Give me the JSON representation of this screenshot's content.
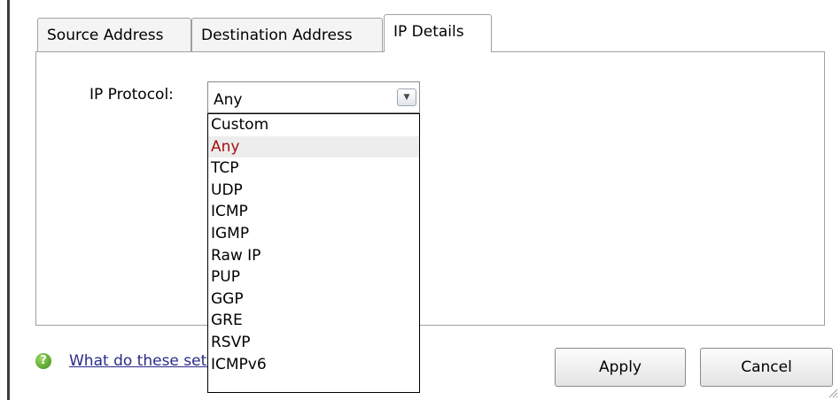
{
  "tabs": [
    {
      "label": "Source Address"
    },
    {
      "label": "Destination Address"
    },
    {
      "label": "IP Details"
    }
  ],
  "active_tab": "IP Details",
  "form": {
    "protocol_label": "IP Protocol:",
    "protocol_value": "Any"
  },
  "dropdown_options": [
    "Custom",
    "Any",
    "TCP",
    "UDP",
    "ICMP",
    "IGMP",
    "Raw IP",
    "PUP",
    "GGP",
    "GRE",
    "RSVP",
    "ICMPv6"
  ],
  "highlighted_option": "Any",
  "help": {
    "link_text": "What do these settings mean?"
  },
  "buttons": {
    "apply": "Apply",
    "cancel": "Cancel"
  },
  "colors": {
    "highlight_text": "#a11010",
    "border": "#a0a0a0"
  }
}
